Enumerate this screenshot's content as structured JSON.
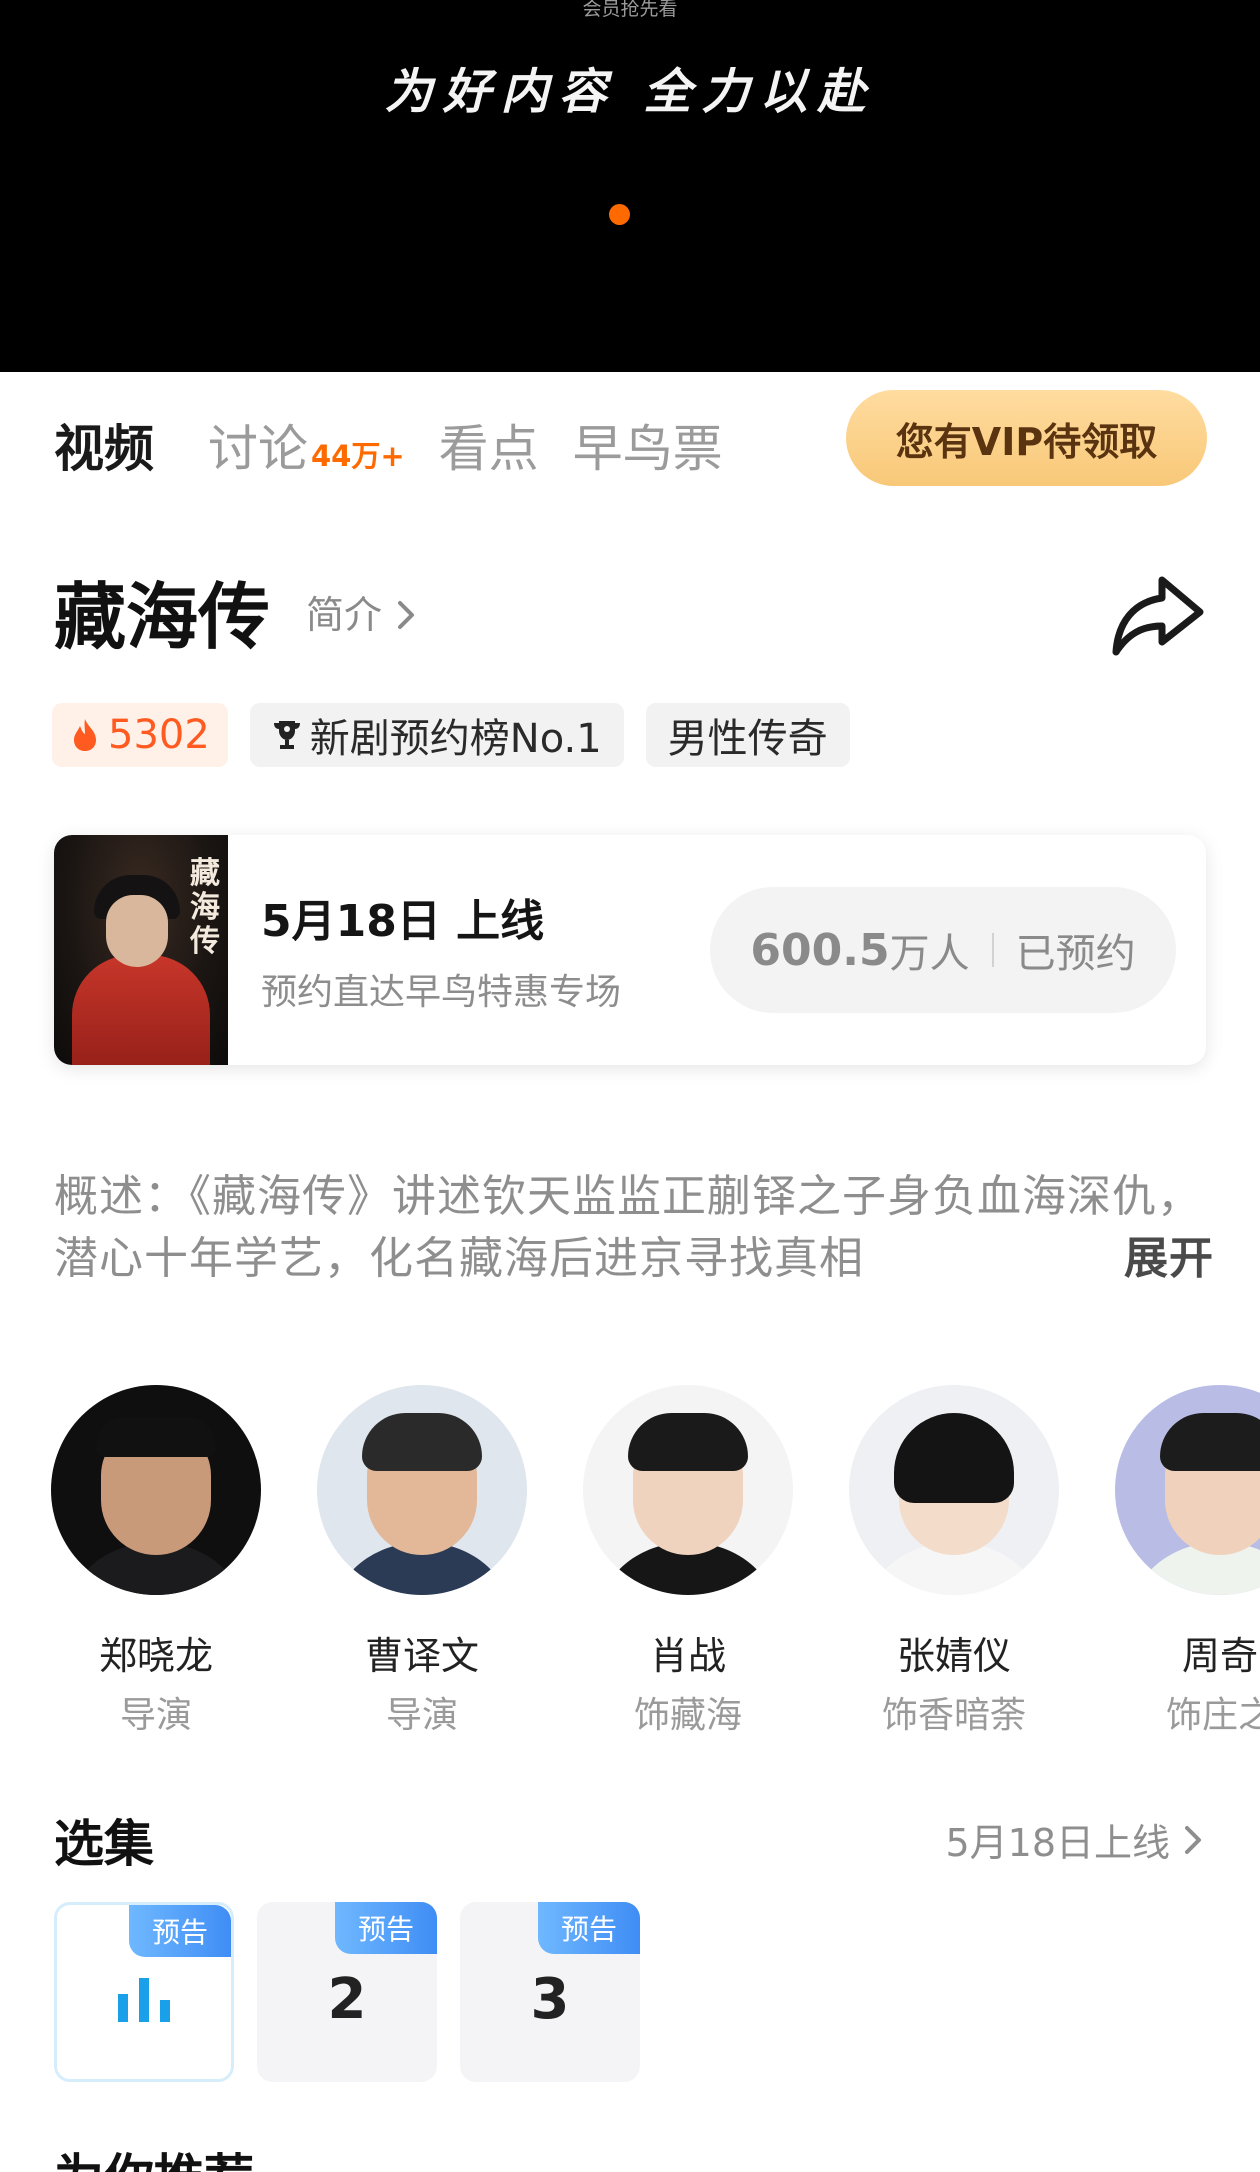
{
  "banner": {
    "vip_preview": "会员抢先看",
    "slogan": "为好内容 全力以赴",
    "accent_color": "#ff6a00"
  },
  "tabs": [
    {
      "label": "视频",
      "active": true
    },
    {
      "label": "讨论",
      "count": "44万+"
    },
    {
      "label": "看点"
    },
    {
      "label": "早鸟票"
    }
  ],
  "vip_claim_label": "您有VIP待领取",
  "show": {
    "title": "藏海传",
    "intro_label": "简介",
    "share_icon": "share-icon"
  },
  "tags": {
    "heat": "5302",
    "rank": "新剧预约榜No.1",
    "genre": "男性传奇"
  },
  "release": {
    "poster_title": "藏海传",
    "date": "5月18日 上线",
    "subtitle": "预约直达早鸟特惠专场",
    "reserved_count": "600.5",
    "reserved_unit": "万人",
    "reserved_state": "已预约"
  },
  "synopsis": {
    "text": "概述：《藏海传》讲述钦天监监正蒯铎之子身负血海深仇，潜心十年学艺，化名藏海后进京寻找真相",
    "more_label": "展开"
  },
  "cast": [
    {
      "name": "郑晓龙",
      "role": "导演"
    },
    {
      "name": "曹译文",
      "role": "导演"
    },
    {
      "name": "肖战",
      "role": "饰藏海"
    },
    {
      "name": "张婧仪",
      "role": "饰香暗荼"
    },
    {
      "name": "周奇",
      "role": "饰庄之"
    }
  ],
  "episodes": {
    "title": "选集",
    "release_link": "5月18日上线",
    "badge": "预告",
    "items": [
      {
        "label": "",
        "playing": true
      },
      {
        "label": "2"
      },
      {
        "label": "3"
      }
    ]
  },
  "next_section_title": "为你推荐"
}
